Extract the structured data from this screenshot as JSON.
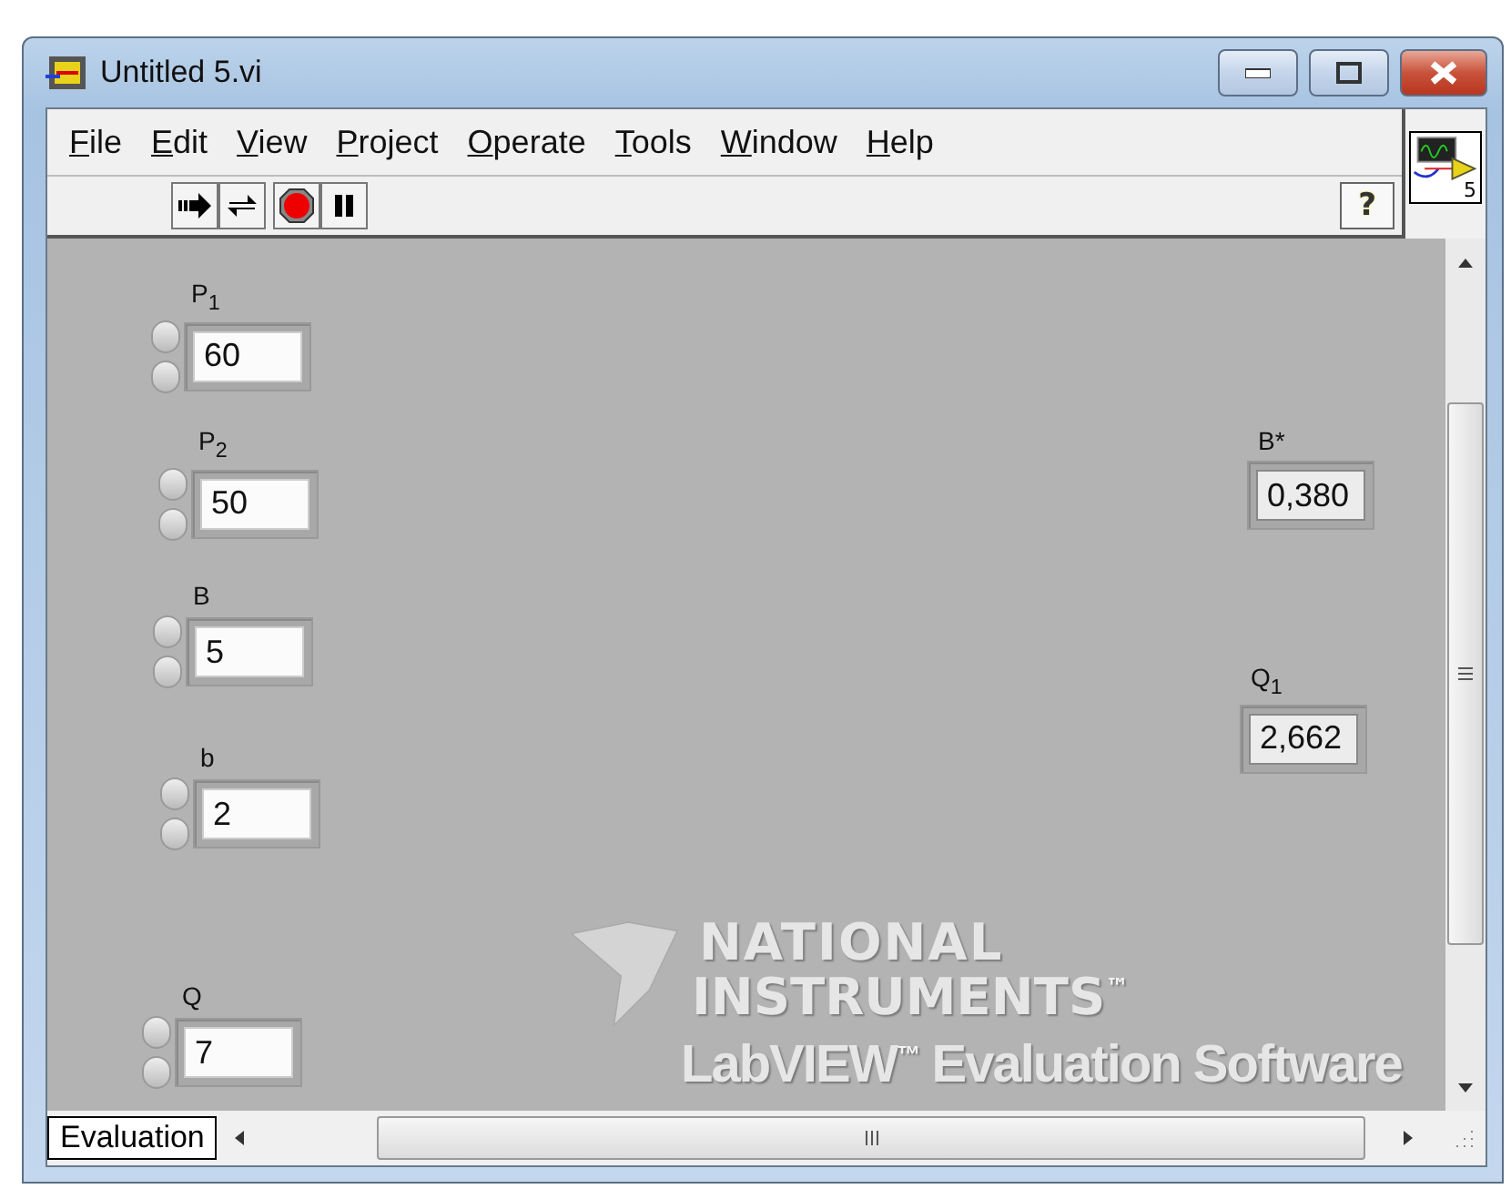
{
  "window": {
    "title": "Untitled 5.vi"
  },
  "menu": [
    "File",
    "Edit",
    "View",
    "Project",
    "Operate",
    "Tools",
    "Window",
    "Help"
  ],
  "toolbar": {
    "help_button": "?"
  },
  "vi_icon": {
    "number": "5"
  },
  "panel": {
    "items": [
      {
        "kind": "control",
        "label": "P$_{1}$",
        "value": "60"
      },
      {
        "kind": "control",
        "label": "P$_{2}$",
        "value": "50"
      },
      {
        "kind": "control",
        "label": "B",
        "value": "5"
      },
      {
        "kind": "control",
        "label": "b",
        "value": "2"
      },
      {
        "kind": "control",
        "label": "Q",
        "value": "7"
      },
      {
        "kind": "indicator",
        "label": "B*",
        "value": "0,380"
      },
      {
        "kind": "indicator",
        "label": "Q$_{1}$",
        "value": "2,662"
      }
    ],
    "watermark": {
      "line_1": "NATIONAL",
      "line_2": "INSTRUMENTS",
      "line_2_mark": "™",
      "line_3_brand": "LabVIEW",
      "line_3_mark": "™",
      "line_3_rest": "Evaluation Software"
    }
  },
  "status": {
    "label": "Evaluation"
  }
}
